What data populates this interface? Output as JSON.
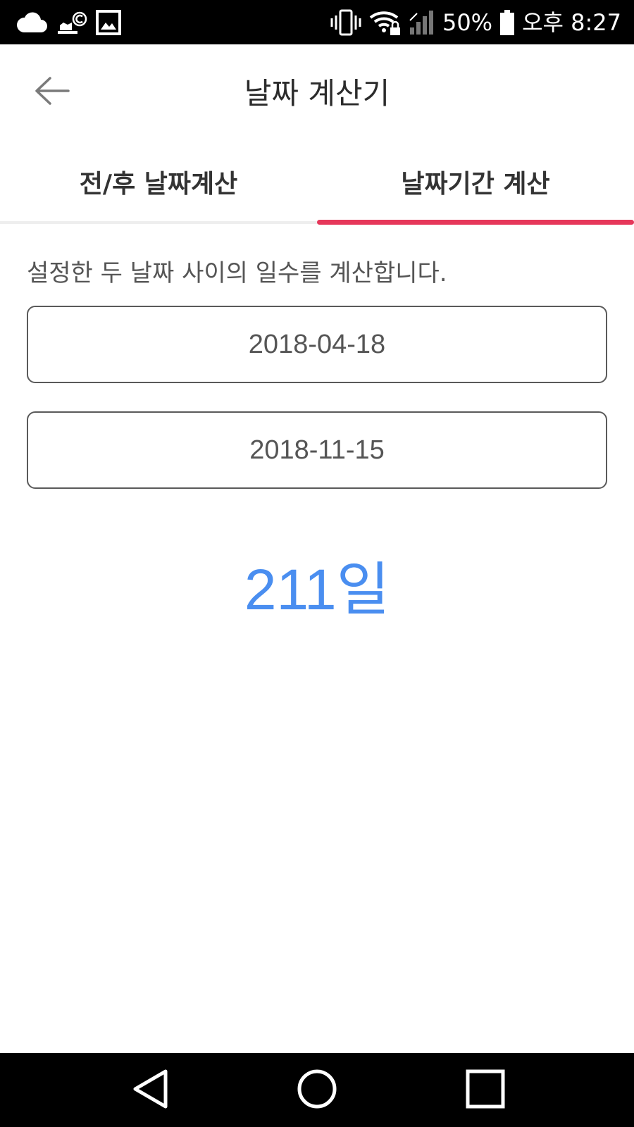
{
  "status_bar": {
    "battery_percent": "50%",
    "time": "오후 8:27",
    "left_icons": [
      "cloud-icon",
      "notification-app-icon",
      "image-icon"
    ],
    "right_icons": [
      "vibrate-icon",
      "wifi-lock-icon",
      "signal-icon",
      "battery-icon"
    ]
  },
  "app_bar": {
    "title": "날짜 계산기",
    "back_icon": "arrow-left-icon"
  },
  "tabs": [
    {
      "label": "전/후 날짜계산",
      "selected": false
    },
    {
      "label": "날짜기간 계산",
      "selected": true
    }
  ],
  "colors": {
    "tab_indicator": "#e6375a",
    "result_text": "#4a8ef0",
    "field_border": "#5a5a5a"
  },
  "calculator": {
    "description": "설정한 두 날짜 사이의 일수를 계산합니다.",
    "start_date": "2018-04-18",
    "end_date": "2018-11-15",
    "result": "211일"
  },
  "nav_bar": {
    "icons": [
      "nav-back-icon",
      "nav-home-icon",
      "nav-recents-icon"
    ]
  }
}
